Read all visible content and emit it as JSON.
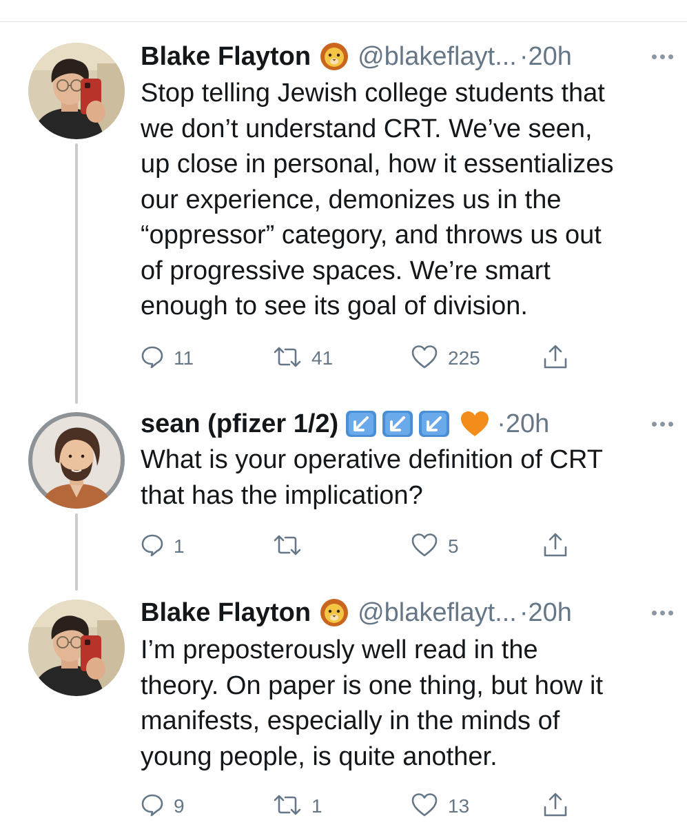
{
  "tweets": [
    {
      "author_name": "Blake Flayton",
      "author_emoji": "lion-face-emoji",
      "handle": "@blakeflayt...",
      "separator": "·",
      "time": "20h",
      "text": "Stop telling Jewish college students that\nwe don’t understand CRT. We’ve seen,\nup close in personal, how it essentializes\nour experience, demonizes us in the\n“oppressor” category, and throws us out\nof progressive spaces. We’re smart\nenough to see its goal of division.",
      "reply_count": "11",
      "retweet_count": "41",
      "like_count": "225"
    },
    {
      "author_name": "sean (pfizer 1/2)",
      "author_emoji": "arrow-down-left-boxes-x3-orange-heart",
      "handle": "",
      "separator": "·",
      "time": "20h",
      "text": "What is your operative definition of CRT\nthat has the implication?",
      "reply_count": "1",
      "retweet_count": "",
      "like_count": "5"
    },
    {
      "author_name": "Blake Flayton",
      "author_emoji": "lion-face-emoji",
      "handle": "@blakeflayt...",
      "separator": "·",
      "time": "20h",
      "text": "I’m preposterously well read in the\ntheory. On paper is one thing, but how it\nmanifests, especially in the minds of\nyoung people, is quite another.",
      "reply_count": "9",
      "retweet_count": "1",
      "like_count": "13"
    }
  ],
  "colors": {
    "text": "#14171a",
    "secondary": "#657786",
    "icon": "#657786",
    "thread_line": "#c7ccd1",
    "emoji_box": "#4a8fd6",
    "heart": "#f28c1a"
  },
  "icons": {
    "reply": "speech-bubble-icon",
    "retweet": "retweet-arrows-icon",
    "like": "heart-outline-icon",
    "share": "share-upload-icon",
    "more": "more-dots-icon"
  }
}
